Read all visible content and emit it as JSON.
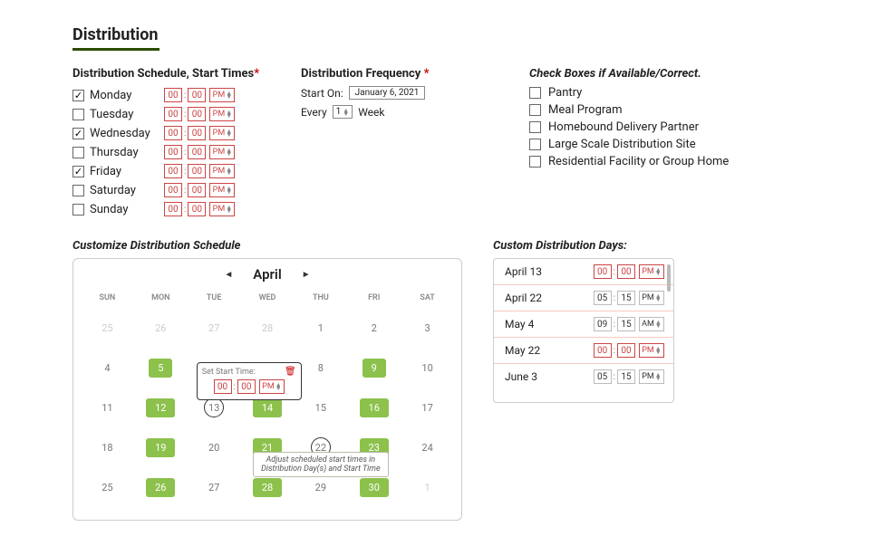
{
  "title": "Distribution",
  "schedule": {
    "heading": "Distribution Schedule, Start Times",
    "days": [
      {
        "name": "Monday",
        "checked": true,
        "h": "00",
        "m": "00",
        "ap": "PM",
        "blank": true
      },
      {
        "name": "Tuesday",
        "checked": false,
        "h": "00",
        "m": "00",
        "ap": "PM",
        "blank": true
      },
      {
        "name": "Wednesday",
        "checked": true,
        "h": "00",
        "m": "00",
        "ap": "PM",
        "blank": true
      },
      {
        "name": "Thursday",
        "checked": false,
        "h": "00",
        "m": "00",
        "ap": "PM",
        "blank": true
      },
      {
        "name": "Friday",
        "checked": true,
        "h": "00",
        "m": "00",
        "ap": "PM",
        "blank": true
      },
      {
        "name": "Saturday",
        "checked": false,
        "h": "00",
        "m": "00",
        "ap": "PM",
        "blank": true
      },
      {
        "name": "Sunday",
        "checked": false,
        "h": "00",
        "m": "00",
        "ap": "PM",
        "blank": true
      }
    ]
  },
  "frequency": {
    "heading": "Distribution Frequency ",
    "start_on_label": "Start On:",
    "start_on_value": "January 6, 2021",
    "every_label": "Every",
    "every_value": "1",
    "every_unit": "Week"
  },
  "availability": {
    "heading": "Check Boxes if Available/Correct.",
    "items": [
      "Pantry",
      "Meal Program",
      "Homebound Delivery Partner",
      "Large Scale Distribution Site",
      "Residential Facility or Group Home"
    ]
  },
  "calendar": {
    "heading": "Customize Distribution Schedule",
    "month": "April",
    "dow": [
      "SUN",
      "MON",
      "TUE",
      "WED",
      "THU",
      "FRI",
      "SAT"
    ],
    "rows": [
      [
        {
          "d": "25",
          "dim": true
        },
        {
          "d": "26",
          "dim": true
        },
        {
          "d": "27",
          "dim": true
        },
        {
          "d": "28",
          "dim": true
        },
        {
          "d": "1"
        },
        {
          "d": "2"
        },
        {
          "d": "3"
        }
      ],
      [
        {
          "d": "4"
        },
        {
          "d": "5",
          "pill": true
        },
        {
          "pop": true
        },
        {
          "d": "8"
        },
        {
          "d": "9",
          "pill": true
        },
        {
          "d": "10"
        }
      ],
      [
        {
          "d": "11"
        },
        {
          "d": "12",
          "pill": true
        },
        {
          "d": "13",
          "circ": true
        },
        {
          "d": "14",
          "pill": true
        },
        {
          "d": "15"
        },
        {
          "d": "16",
          "pill": true
        },
        {
          "d": "17"
        }
      ],
      [
        {
          "d": "18"
        },
        {
          "d": "19",
          "pill": true
        },
        {
          "d": "20"
        },
        {
          "d": "21",
          "pill": true
        },
        {
          "d": "22",
          "circ": true,
          "tip": true
        },
        {
          "d": "23",
          "pill": true
        },
        {
          "d": "24"
        }
      ],
      [
        {
          "d": "25"
        },
        {
          "d": "26",
          "pill": true
        },
        {
          "d": "27"
        },
        {
          "d": "28",
          "pill": true
        },
        {
          "d": "29"
        },
        {
          "d": "30",
          "pill": true
        },
        {
          "d": "1",
          "dim": true
        }
      ]
    ],
    "popover_label": "Set Start Time:",
    "popover_h": "00",
    "popover_m": "00",
    "popover_ap": "PM",
    "tooltip": "Adjust scheduled start times in Distribution Day(s) and Start Time"
  },
  "custom": {
    "heading": "Custom Distribution Days:",
    "rows": [
      {
        "label": "April 13",
        "h": "00",
        "m": "00",
        "ap": "PM",
        "blank": true
      },
      {
        "label": "April 22",
        "h": "05",
        "m": "15",
        "ap": "PM"
      },
      {
        "label": "May 4",
        "h": "09",
        "m": "15",
        "ap": "AM"
      },
      {
        "label": "May 22",
        "h": "00",
        "m": "00",
        "ap": "PM",
        "blank": true
      },
      {
        "label": "June 3",
        "h": "05",
        "m": "15",
        "ap": "PM"
      }
    ]
  }
}
